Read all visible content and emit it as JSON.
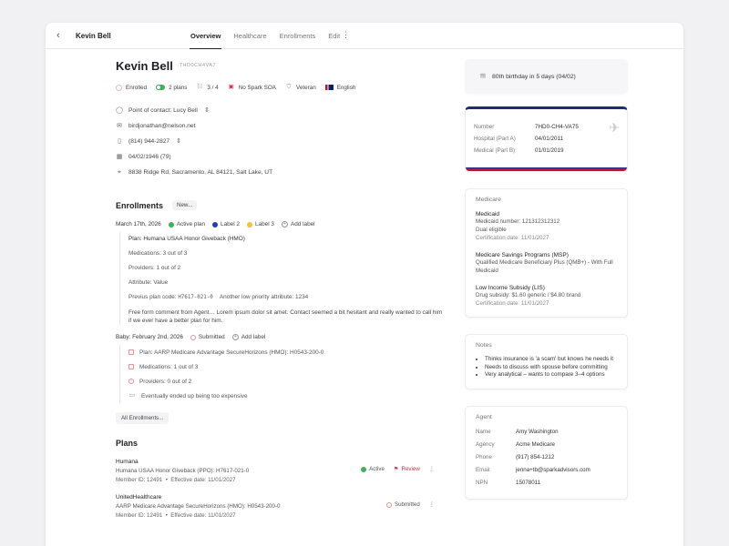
{
  "header": {
    "name": "Kevin Bell",
    "tabs": [
      {
        "label": "Overview",
        "active": true
      },
      {
        "label": "Healthcare",
        "active": false
      },
      {
        "label": "Enrollments",
        "active": false
      },
      {
        "label": "Edit",
        "active": false
      }
    ]
  },
  "profile": {
    "name": "Kevin Bell",
    "id_tag": "7HD0CH4VA7",
    "chips": {
      "enrolled": "Enrolled",
      "plans": "2 plans",
      "rating": "3 / 4",
      "soa": "No Spark SOA",
      "veteran": "Veteran",
      "language": "English"
    },
    "contact": {
      "point_of_contact": "Point of contact: Lucy Bell",
      "email": "birdjonathan@nelson.net",
      "phone": "(814) 944-2827",
      "dob": "04/02/1946 (79)",
      "address": "8838 Ridge Rd, Sacramento, AL 84121, Salt Lake, UT"
    }
  },
  "enrollments": {
    "title": "Enrollments",
    "new_button": "New...",
    "group1": {
      "date": "March 17th, 2026",
      "status": "Active plan",
      "label2": "Label 2",
      "label3": "Label 3",
      "add_label": "Add label",
      "plan": "Plan: Humana USAA Honor Giveback (HMO)",
      "medications": "Medications: 3 out of 3",
      "providers": "Providers: 1 out of 2",
      "attribute": "Attribute: Value",
      "prev_plan_label": "Previus plan code:",
      "prev_plan_code": "H7617-021-0",
      "low_priority": "Another low priority attribute: 1234",
      "comment": "Free form comment from Agent… Lorem ipsum dolor sit amet. Contact seemed a bit hesitant and really wanted to call him if we ever have a better plan for him."
    },
    "group2": {
      "date": "Baby: February 2nd, 2026",
      "status": "Submitted",
      "add_label": "Add label",
      "plan": "Plan: AARP Medicare Advantage SecureHorizons (HMO): H0543-200-0",
      "medications": "Medications: 1 out of 3",
      "providers": "Providers: 0 out of 2",
      "comment": "Eventually ended up being too expensive"
    },
    "all_button": "All Enrollments..."
  },
  "plans": {
    "title": "Plans",
    "items": [
      {
        "carrier": "Humana",
        "name": "Humana USAA Honor Giveback (PPO): H7617-021-0",
        "member": "Member ID: 12491",
        "effective": "Effective date: 11/01/2027",
        "status": "Active",
        "review": "Review"
      },
      {
        "carrier": "UnitedHealthcare",
        "name": "AARP Medicare Advantage SecureHorizons (HMO): H0543-200-0",
        "member": "Member ID: 12491",
        "effective": "Effective date: 11/01/2027",
        "status": "Submitted"
      }
    ]
  },
  "sidebar": {
    "birthday": "80th birthday in 5 days (04/02)",
    "medicare_card": {
      "number_label": "Number",
      "number": "7HD0-CH4-VA75",
      "hospital_label": "Hospital (Part A)",
      "hospital": "04/01/2011",
      "medical_label": "Medical (Part B)",
      "medical": "01/01/2019"
    },
    "medicare": {
      "title": "Medicare",
      "medicaid_title": "Medicaid",
      "medicaid_number": "Medicaid number: 121312312312",
      "dual": "Dual eligible",
      "cert1": "Certification date: 11/01/2027",
      "msp_title": "Medicare Savings Programs (MSP)",
      "msp_desc": "Qualified Medicare Beneficiary Plus (QMB+) - With Full Medicaid",
      "lis_title": "Low Income Subsidy (LIS)",
      "lis_desc": "Drug subsidy: $1.60 generic / $4.80 brand",
      "cert2": "Certification date: 11/01/2027"
    },
    "notes": {
      "title": "Notes",
      "items": [
        "Thinks insurance is 'a scam' but knows he needs it",
        "Needs to discuss with spouse before committing",
        "Very analytical – wants to compare 3–4 options"
      ]
    },
    "agent": {
      "title": "Agent",
      "rows": [
        {
          "k": "Name",
          "v": "Amy Washington"
        },
        {
          "k": "Agency",
          "v": "Acme Medicare"
        },
        {
          "k": "Phone",
          "v": "(917) 854-1212"
        },
        {
          "k": "Email",
          "v": "jenna+tb@sparkadvisors.com"
        },
        {
          "k": "NPN",
          "v": "15078011"
        }
      ]
    }
  },
  "colors": {
    "active_green": "#3bb35a",
    "label2_blue": "#1f3fb8",
    "label3_yellow": "#f2c230",
    "review_red": "#d6304b",
    "card_blue": "#1d2b7a",
    "card_red": "#c8102e"
  }
}
